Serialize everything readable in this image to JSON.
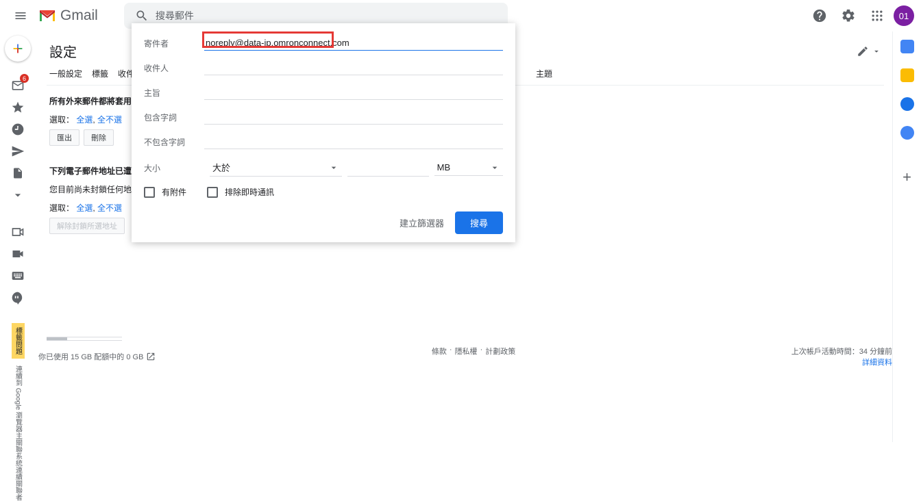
{
  "header": {
    "app_name": "Gmail",
    "search_placeholder": "搜尋郵件",
    "avatar_text": "01"
  },
  "left_nav": {
    "inbox_badge": "6",
    "yellow_label": "標籤問題",
    "vertical_note": "連續到 Google 瀏覽器主關聯系統連續關聯者"
  },
  "main": {
    "title": "設定",
    "tabs": [
      "一般設定",
      "標籤",
      "收件匣"
    ],
    "hidden_tab_after_panel": "主題",
    "section1_title": "所有外來郵件都將套用下列",
    "select_label": "選取：",
    "select_all": "全選",
    "select_none": "全不選",
    "btn_export": "匯出",
    "btn_delete": "刪除",
    "section2_title": "下列電子郵件地址已遭封鎖",
    "section2_body": "您目前尚未封鎖任何地址",
    "btn_unblock": "解除封鎖所選地址"
  },
  "panel": {
    "labels": {
      "from": "寄件者",
      "to": "收件人",
      "subject": "主旨",
      "includes": "包含字詞",
      "excludes": "不包含字詞",
      "size": "大小",
      "size_op": "大於",
      "size_unit": "MB",
      "has_attach": "有附件",
      "exclude_chat": "排除即時通訊"
    },
    "from_value": "noreply@data-jp.omronconnect.com",
    "actions": {
      "create_filter": "建立篩選器",
      "search": "搜尋"
    }
  },
  "footer": {
    "storage": "你已使用 15 GB 配額中的 0 GB",
    "terms": "條款",
    "privacy": "隱私權",
    "policies": "計劃政策",
    "activity": "上次帳戶活動時間：34 分鐘前",
    "details": "詳細資料"
  }
}
